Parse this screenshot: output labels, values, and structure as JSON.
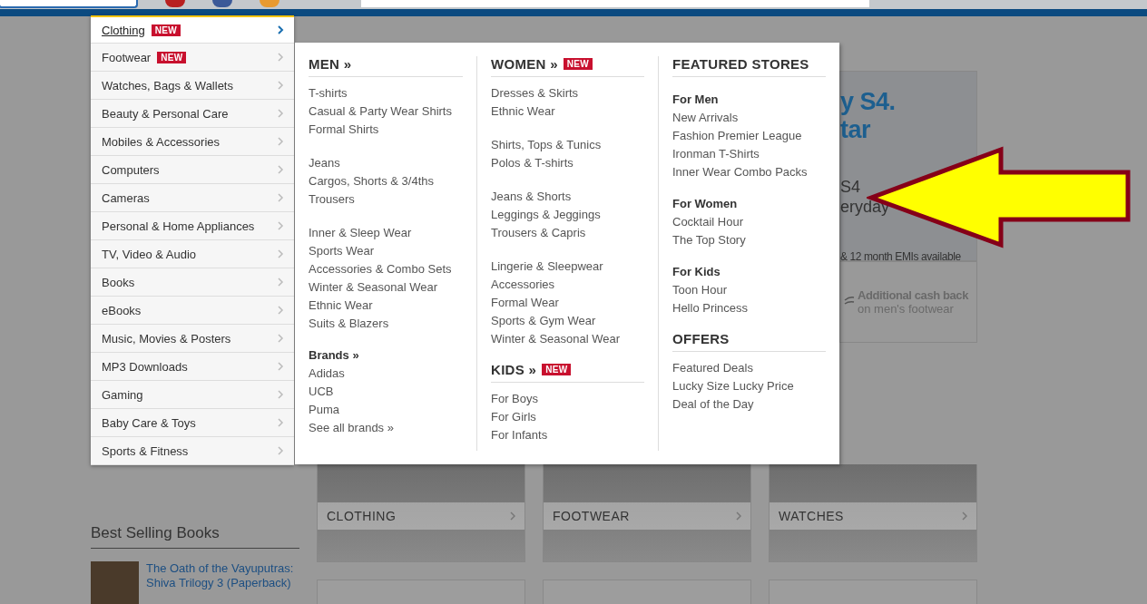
{
  "category_menu": [
    {
      "label": "Clothing",
      "badge": "NEW",
      "selected": true
    },
    {
      "label": "Footwear",
      "badge": "NEW",
      "selected": false
    },
    {
      "label": "Watches, Bags & Wallets",
      "selected": false
    },
    {
      "label": "Beauty & Personal Care",
      "selected": false
    },
    {
      "label": "Mobiles & Accessories",
      "selected": false
    },
    {
      "label": "Computers",
      "selected": false
    },
    {
      "label": "Cameras",
      "selected": false
    },
    {
      "label": "Personal & Home Appliances",
      "selected": false
    },
    {
      "label": "TV, Video & Audio",
      "selected": false
    },
    {
      "label": "Books",
      "selected": false
    },
    {
      "label": "eBooks",
      "selected": false
    },
    {
      "label": "Music, Movies & Posters",
      "selected": false
    },
    {
      "label": "MP3 Downloads",
      "selected": false
    },
    {
      "label": "Gaming",
      "selected": false
    },
    {
      "label": "Baby Care & Toys",
      "selected": false
    },
    {
      "label": "Sports & Fitness",
      "selected": false
    }
  ],
  "mega_menu": {
    "columns": [
      {
        "sections": [
          {
            "kind": "major",
            "title": "MEN »",
            "groups": [
              [
                "T-shirts",
                "Casual & Party Wear Shirts",
                "Formal Shirts"
              ],
              [
                "Jeans",
                "Cargos, Shorts & 3/4ths",
                "Trousers"
              ],
              [
                "Inner & Sleep Wear",
                "Sports Wear",
                "Accessories & Combo Sets",
                "Winter & Seasonal Wear",
                "Ethnic Wear",
                "Suits & Blazers"
              ]
            ]
          },
          {
            "kind": "minor",
            "title": "Brands »",
            "groups": [
              [
                "Adidas",
                "UCB",
                "Puma",
                "See all brands »"
              ]
            ]
          }
        ]
      },
      {
        "sections": [
          {
            "kind": "major",
            "title": "WOMEN »",
            "badge": "NEW",
            "groups": [
              [
                "Dresses & Skirts",
                "Ethnic Wear"
              ],
              [
                "Shirts, Tops & Tunics",
                "Polos & T-shirts"
              ],
              [
                "Jeans & Shorts",
                "Leggings & Jeggings",
                "Trousers & Capris"
              ],
              [
                "Lingerie & Sleepwear",
                "Accessories",
                "Formal Wear",
                "Sports & Gym Wear",
                "Winter & Seasonal Wear"
              ]
            ]
          },
          {
            "kind": "major",
            "title": "KIDS »",
            "badge": "NEW",
            "groups": [
              [
                "For Boys",
                "For Girls",
                "For Infants"
              ]
            ]
          }
        ]
      },
      {
        "sections": [
          {
            "kind": "major",
            "title": "FEATURED STORES"
          },
          {
            "kind": "minor",
            "title": "For Men",
            "groups": [
              [
                "New Arrivals",
                "Fashion Premier League",
                "Ironman T-Shirts",
                "Inner Wear Combo Packs"
              ]
            ]
          },
          {
            "kind": "minor",
            "title": "For Women",
            "groups": [
              [
                "Cocktail Hour",
                "The Top Story"
              ]
            ]
          },
          {
            "kind": "minor",
            "title": "For Kids",
            "groups": [
              [
                "Toon Hour",
                "Hello Princess"
              ]
            ]
          },
          {
            "kind": "major",
            "title": "OFFERS",
            "groups": [
              [
                "Featured Deals",
                "Lucky Size Lucky Price",
                "Deal of the Day"
              ]
            ]
          }
        ]
      }
    ]
  },
  "banner": {
    "headline": [
      "y S4.",
      "tar"
    ],
    "subline": [
      "S4",
      "eryday"
    ],
    "note": "& 12 month EMIs available"
  },
  "promo": {
    "title": "Additional cash back",
    "subtitle": "on men's footwear"
  },
  "tiles": [
    {
      "label": "CLOTHING"
    },
    {
      "label": "FOOTWEAR"
    },
    {
      "label": "WATCHES"
    }
  ],
  "best_selling": {
    "title": "Best Selling Books",
    "books": [
      {
        "title": "The Oath of the Vayuputras: Shiva Trilogy 3 (Paperback)"
      }
    ]
  }
}
